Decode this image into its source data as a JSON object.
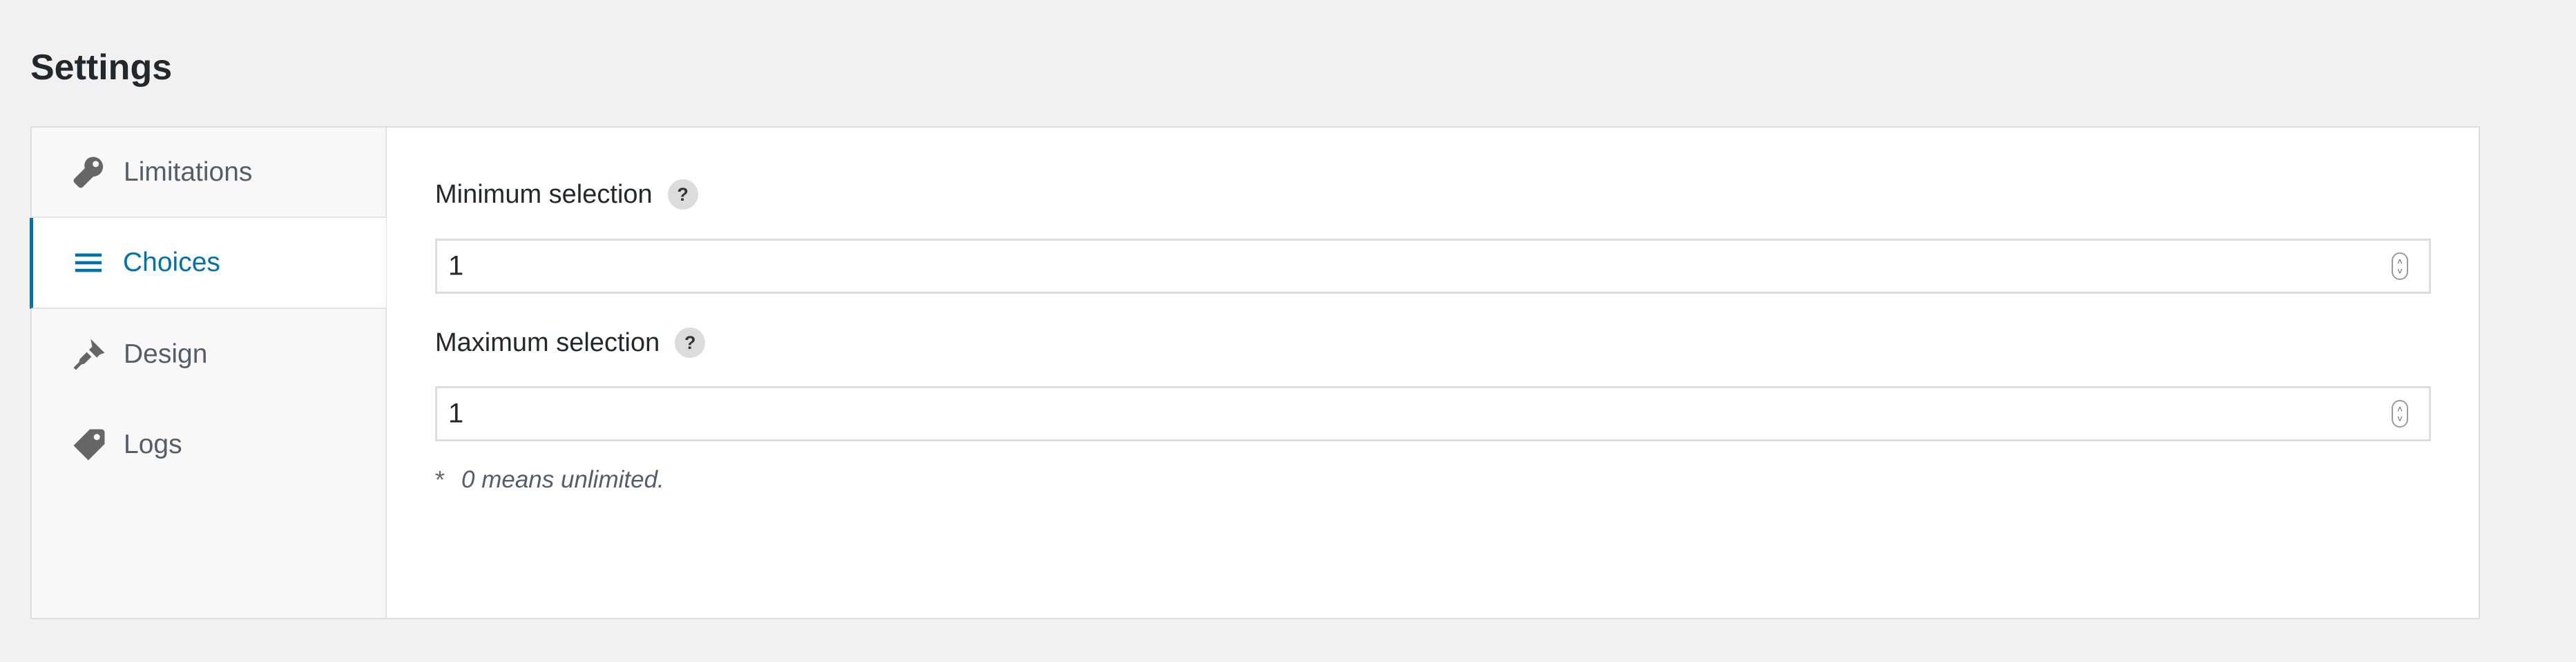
{
  "page": {
    "title": "Settings"
  },
  "sidebar": {
    "active_color": "#0073aa",
    "items": [
      {
        "label": "Limitations",
        "icon": "wrench-icon"
      },
      {
        "label": "Choices",
        "icon": "list-icon",
        "active": true
      },
      {
        "label": "Design",
        "icon": "paintbrush-icon"
      },
      {
        "label": "Logs",
        "icon": "tag-icon"
      }
    ]
  },
  "main": {
    "min_selection": {
      "label": "Minimum selection",
      "help": "?",
      "value": "1"
    },
    "max_selection": {
      "label": "Maximum selection",
      "help": "?",
      "value": "1"
    },
    "note": {
      "marker": "*",
      "text": "0 means unlimited."
    }
  }
}
